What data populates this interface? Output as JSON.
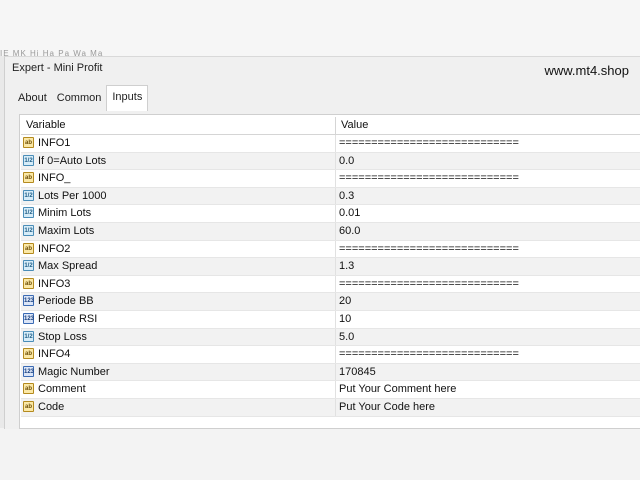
{
  "window": {
    "title": "Expert - Mini Profit",
    "watermark": "www.mt4.shop",
    "background_text": "IE MK Hi Ha Pa Wa Ma"
  },
  "tabs": [
    {
      "label": "About",
      "active": false
    },
    {
      "label": "Common",
      "active": false
    },
    {
      "label": "Inputs",
      "active": true
    }
  ],
  "grid": {
    "headers": {
      "variable": "Variable",
      "value": "Value"
    },
    "rows": [
      {
        "type": "ab",
        "type_label": "ab",
        "name": "INFO1",
        "value": "============================"
      },
      {
        "type": "dbl",
        "type_label": "1/2",
        "name": "If 0=Auto Lots",
        "value": "0.0"
      },
      {
        "type": "ab",
        "type_label": "ab",
        "name": "INFO_",
        "value": "============================"
      },
      {
        "type": "dbl",
        "type_label": "1/2",
        "name": "Lots Per 1000",
        "value": "0.3"
      },
      {
        "type": "dbl",
        "type_label": "1/2",
        "name": "Minim Lots",
        "value": "0.01"
      },
      {
        "type": "dbl",
        "type_label": "1/2",
        "name": "Maxim Lots",
        "value": "60.0"
      },
      {
        "type": "ab",
        "type_label": "ab",
        "name": "INFO2",
        "value": "============================"
      },
      {
        "type": "dbl",
        "type_label": "1/2",
        "name": "Max Spread",
        "value": "1.3"
      },
      {
        "type": "ab",
        "type_label": "ab",
        "name": "INFO3",
        "value": "============================"
      },
      {
        "type": "int",
        "type_label": "123",
        "name": "Periode BB",
        "value": "20"
      },
      {
        "type": "int",
        "type_label": "123",
        "name": "Periode RSI",
        "value": "10"
      },
      {
        "type": "dbl",
        "type_label": "1/2",
        "name": "Stop Loss",
        "value": "5.0"
      },
      {
        "type": "ab",
        "type_label": "ab",
        "name": "INFO4",
        "value": "============================"
      },
      {
        "type": "int",
        "type_label": "123",
        "name": "Magic Number",
        "value": "170845"
      },
      {
        "type": "ab",
        "type_label": "ab",
        "name": "Comment",
        "value": "Put Your Comment here"
      },
      {
        "type": "ab",
        "type_label": "ab",
        "name": "Code",
        "value": "Put Your Code here"
      }
    ]
  }
}
